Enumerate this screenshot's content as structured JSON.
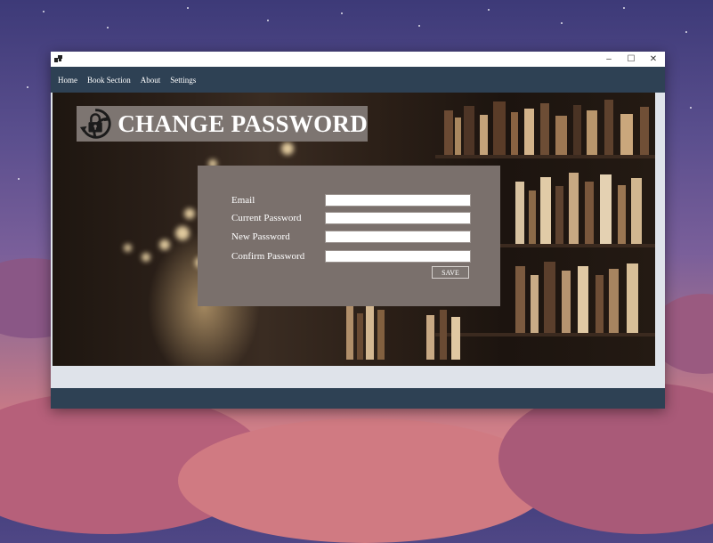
{
  "window": {
    "controls": {
      "minimize": "–",
      "maximize": "☐",
      "close": "✕"
    }
  },
  "menu": {
    "items": [
      "Home",
      "Book Section",
      "About",
      "Settings"
    ]
  },
  "page": {
    "title": "CHANGE PASSWORD",
    "title_icon": "lock-rotate-icon"
  },
  "form": {
    "fields": [
      {
        "label": "Email",
        "value": ""
      },
      {
        "label": "Current Password",
        "value": ""
      },
      {
        "label": "New Password",
        "value": ""
      },
      {
        "label": "Confirm Password",
        "value": ""
      }
    ],
    "save_label": "SAVE"
  },
  "colors": {
    "menubar": "#2e4154",
    "panel": "#7a706c",
    "title_box": "#7d7571"
  }
}
